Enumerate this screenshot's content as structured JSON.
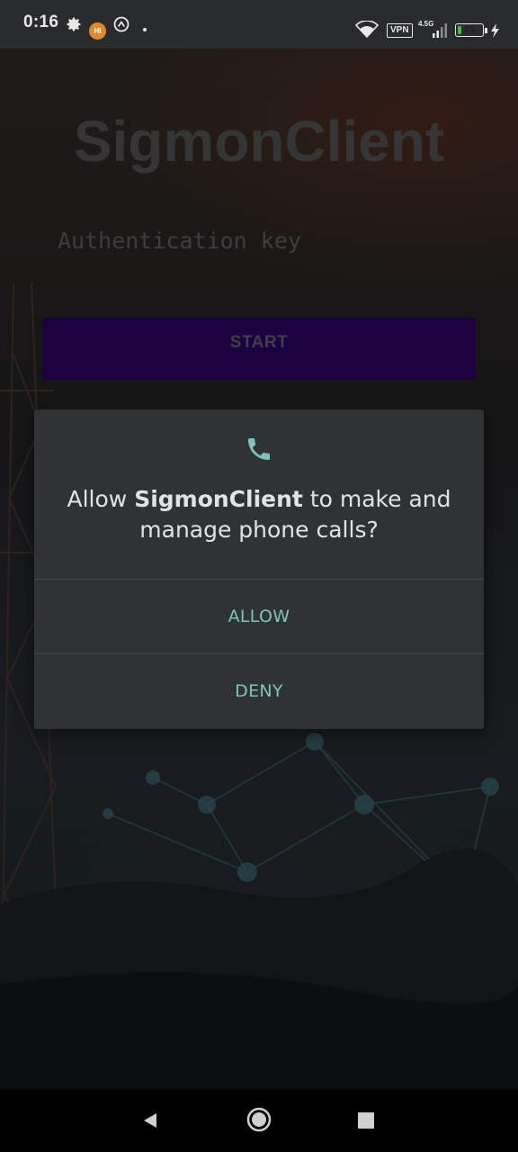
{
  "status_bar": {
    "time": "0:16",
    "icons": [
      "gear-icon",
      "app-badge-icon",
      "nfc-icon",
      "dot-icon",
      "wifi-icon",
      "vpn-icon",
      "network-4.5g-icon",
      "signal-icon",
      "battery-icon",
      "charging-icon"
    ],
    "vpn_label": "VPN",
    "network_label": "4.5G",
    "battery_level": "15",
    "battery_fraction": 0.15,
    "app_badge": "HI"
  },
  "app": {
    "title": "SigmonClient",
    "auth_placeholder": "Authentication key",
    "start_label": "START",
    "colors": {
      "start_button": "#22004a"
    }
  },
  "dialog": {
    "icon": "phone-icon",
    "message_prefix": "Allow ",
    "message_app": "SigmonClient",
    "message_suffix": " to make and manage phone calls?",
    "allow_label": "ALLOW",
    "deny_label": "DENY",
    "colors": {
      "background": "#2f3336",
      "accent": "#7fc4bb"
    }
  },
  "nav_bar": {
    "icons": [
      "back-icon",
      "home-icon",
      "recents-icon"
    ]
  }
}
